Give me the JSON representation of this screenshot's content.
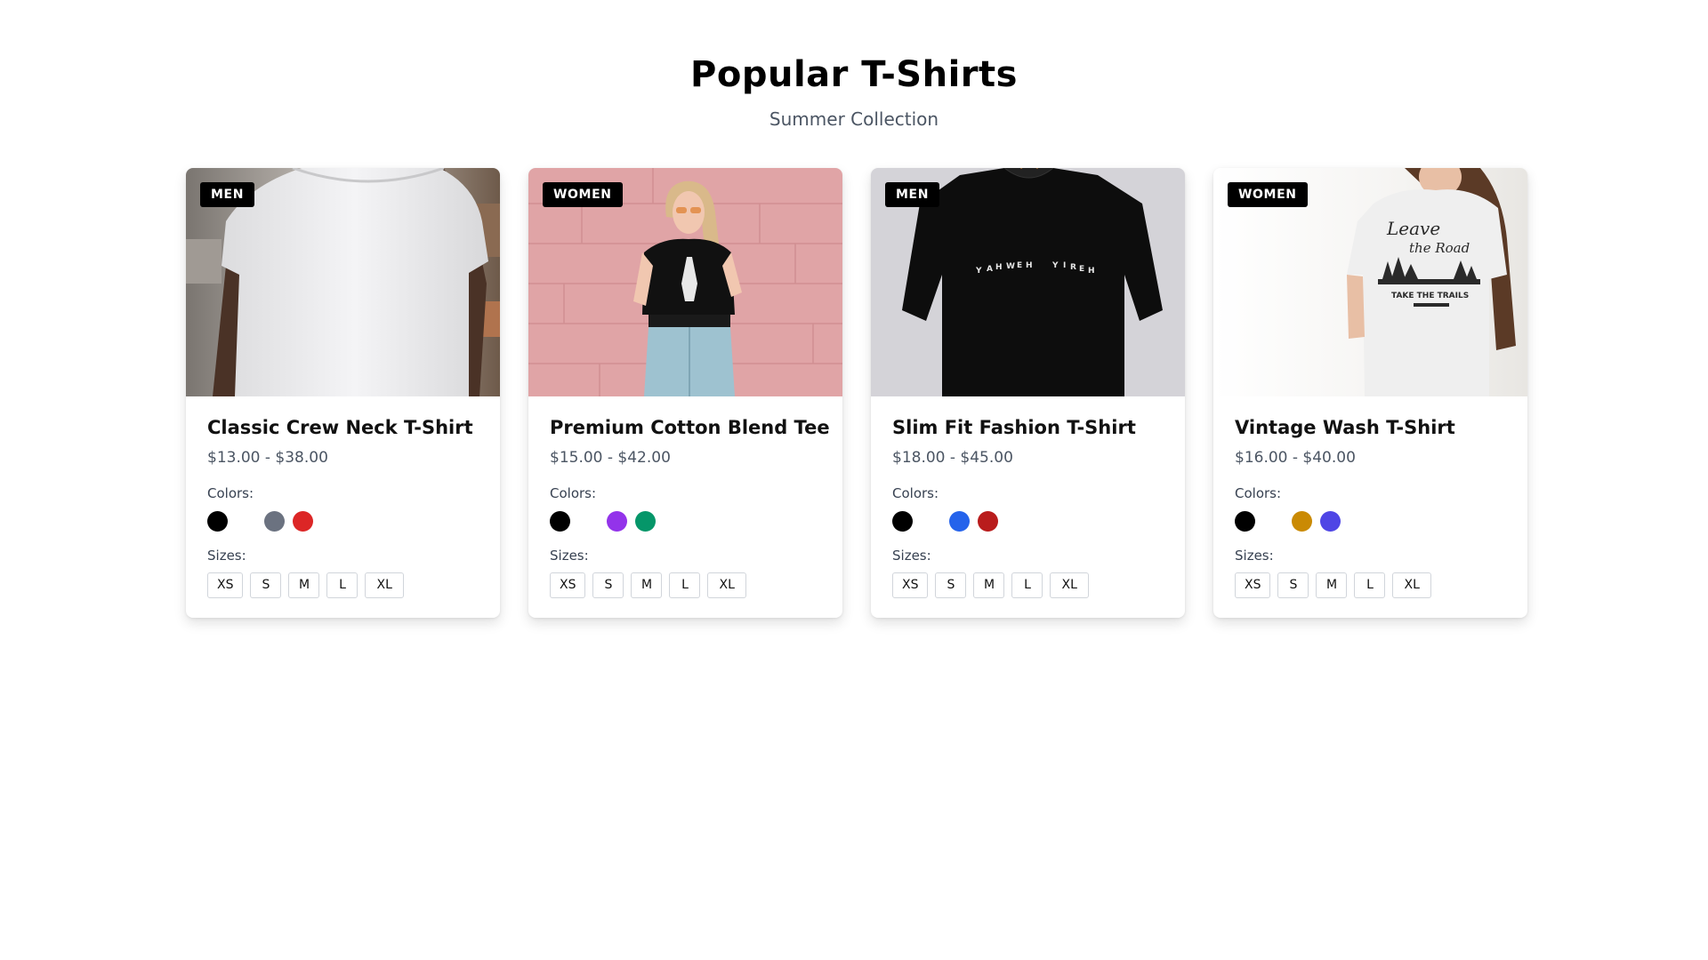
{
  "header": {
    "title": "Popular T-Shirts",
    "subtitle": "Summer Collection"
  },
  "labels": {
    "colors": "Colors:",
    "sizes": "Sizes:"
  },
  "products": [
    {
      "badge": "MEN",
      "name": "Classic Crew Neck T-Shirt",
      "price": "$13.00 - $38.00",
      "colors": [
        "#000000",
        "#ffffff",
        "#6b7280",
        "#dc2626"
      ],
      "sizes": [
        "XS",
        "S",
        "M",
        "L",
        "XL"
      ],
      "image": "white-tshirt-model-photo"
    },
    {
      "badge": "WOMEN",
      "name": "Premium Cotton Blend Tee",
      "price": "$15.00 - $42.00",
      "colors": [
        "#000000",
        "#ffffff",
        "#9333ea",
        "#059669"
      ],
      "sizes": [
        "XS",
        "S",
        "M",
        "L",
        "XL"
      ],
      "image": "woman-black-tee-pink-wall-photo"
    },
    {
      "badge": "MEN",
      "name": "Slim Fit Fashion T-Shirt",
      "price": "$18.00 - $45.00",
      "colors": [
        "#000000",
        "#ffffff",
        "#2563eb",
        "#b91c1c"
      ],
      "sizes": [
        "XS",
        "S",
        "M",
        "L",
        "XL"
      ],
      "image": "black-tshirt-hanger-photo"
    },
    {
      "badge": "WOMEN",
      "name": "Vintage Wash T-Shirt",
      "price": "$16.00 - $40.00",
      "colors": [
        "#000000",
        "#ffffff",
        "#ca8a04",
        "#4f46e5"
      ],
      "sizes": [
        "XS",
        "S",
        "M",
        "L",
        "XL"
      ],
      "image": "woman-white-graphic-tee-photo"
    }
  ]
}
